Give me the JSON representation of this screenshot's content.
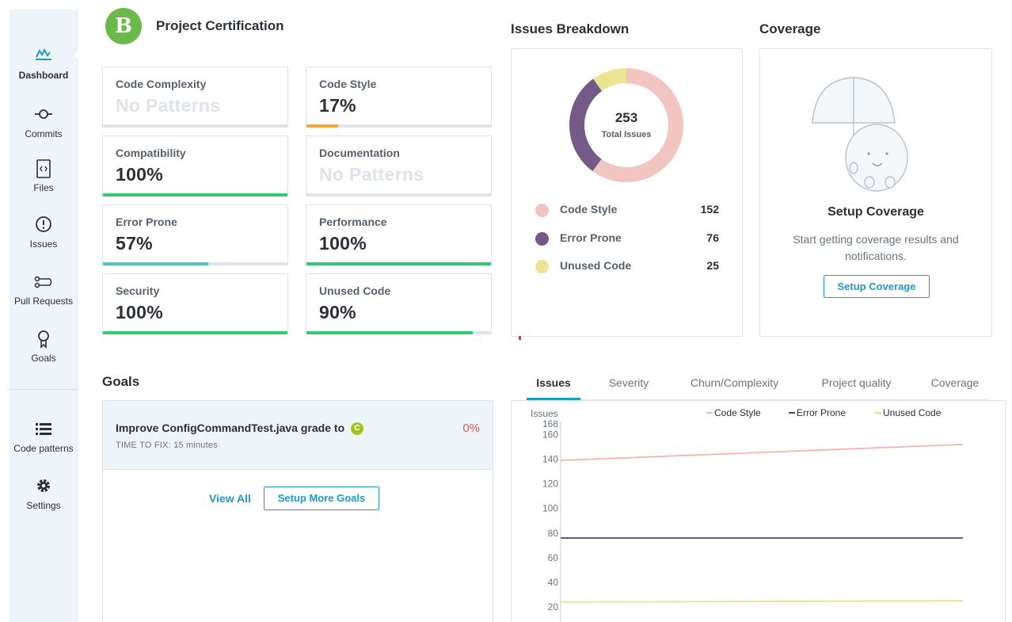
{
  "sidebar": {
    "items": [
      {
        "label": "Dashboard",
        "icon": "dashboard-icon"
      },
      {
        "label": "Commits",
        "icon": "commit-icon"
      },
      {
        "label": "Files",
        "icon": "file-code-icon"
      },
      {
        "label": "Issues",
        "icon": "alert-circle-icon"
      },
      {
        "label": "Pull Requests",
        "icon": "pull-request-icon"
      },
      {
        "label": "Goals",
        "icon": "goal-ribbon-icon"
      },
      {
        "label": "Code patterns",
        "icon": "list-icon"
      },
      {
        "label": "Settings",
        "icon": "gear-icon"
      }
    ],
    "active": "Dashboard"
  },
  "certification": {
    "title": "Project Certification",
    "grade": "B",
    "metrics": [
      {
        "label": "Code Complexity",
        "value": "No Patterns",
        "progress": 0,
        "color": "#dde3e9"
      },
      {
        "label": "Code Style",
        "value": "17%",
        "progress": 0.17,
        "color": "#f5a53a"
      },
      {
        "label": "Compatibility",
        "value": "100%",
        "progress": 1.0,
        "color": "#2fcc71"
      },
      {
        "label": "Documentation",
        "value": "No Patterns",
        "progress": 0,
        "color": "#dde3e9"
      },
      {
        "label": "Error Prone",
        "value": "57%",
        "progress": 0.57,
        "color": "#4fc7c4"
      },
      {
        "label": "Performance",
        "value": "100%",
        "progress": 1.0,
        "color": "#2fcc71"
      },
      {
        "label": "Security",
        "value": "100%",
        "progress": 1.0,
        "color": "#2fcc71"
      },
      {
        "label": "Unused Code",
        "value": "90%",
        "progress": 0.9,
        "color": "#2fcc71"
      }
    ]
  },
  "issues_breakdown": {
    "title": "Issues Breakdown",
    "total": "253",
    "total_label": "Total Issues",
    "categories": [
      {
        "label": "Code Style",
        "count": "152",
        "color": "#f2c5c0"
      },
      {
        "label": "Error Prone",
        "count": "76",
        "color": "#745a86"
      },
      {
        "label": "Unused Code",
        "count": "25",
        "color": "#ece495"
      }
    ]
  },
  "coverage": {
    "title": "Coverage",
    "heading": "Setup Coverage",
    "text": "Start getting coverage results and notifications.",
    "button": "Setup Coverage"
  },
  "goals": {
    "title": "Goals",
    "item": {
      "title": "Improve ConfigCommandTest.java grade to",
      "grade": "C",
      "time_to_fix": "TIME TO FIX: 15 minutes",
      "progress": "0%"
    },
    "view_all": "View All",
    "setup_more": "Setup More Goals"
  },
  "tabs": [
    "Issues",
    "Severity",
    "Churn/Complexity",
    "Project quality",
    "Coverage"
  ],
  "active_tab": "Issues",
  "chart_data": {
    "type": "line",
    "ylabel": "Issues",
    "y_ticks": [
      20,
      40,
      60,
      80,
      100,
      120,
      140,
      160,
      168
    ],
    "ylim": [
      10,
      168
    ],
    "legend_position": "top",
    "series": [
      {
        "name": "Code Style",
        "color": "#f2b7b0",
        "values": [
          139,
          152
        ]
      },
      {
        "name": "Error Prone",
        "color": "#5b3f75",
        "values": [
          76,
          76
        ]
      },
      {
        "name": "Unused Code",
        "color": "#ece08a",
        "values": [
          24,
          25
        ]
      }
    ]
  }
}
